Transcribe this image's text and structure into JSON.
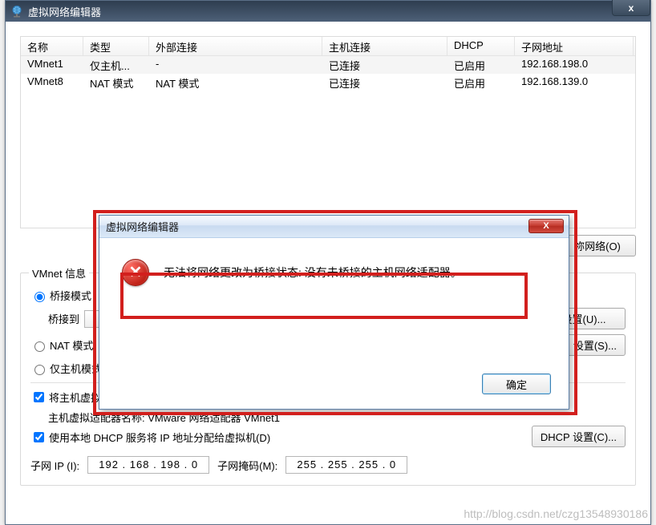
{
  "main_window": {
    "title": "虚拟网络编辑器",
    "close_glyph": "x"
  },
  "table": {
    "headers": {
      "name": "名称",
      "type": "类型",
      "external": "外部连接",
      "host_conn": "主机连接",
      "dhcp": "DHCP",
      "subnet": "子网地址"
    },
    "rows": [
      {
        "name": "VMnet1",
        "type": "仅主机...",
        "external": "-",
        "host_conn": "已连接",
        "dhcp": "已启用",
        "subnet": "192.168.198.0"
      },
      {
        "name": "VMnet8",
        "type": "NAT 模式",
        "external": "NAT 模式",
        "host_conn": "已连接",
        "dhcp": "已启用",
        "subnet": "192.168.139.0"
      }
    ]
  },
  "right_buttons": {
    "add_network_partial": "祢网络(O)"
  },
  "group": {
    "title": "VMnet 信息",
    "bridge_radio": "桥接模式",
    "bridge_to_label": "桥接到",
    "auto_settings_btn": "设置(U)...",
    "nat_radio": "NAT 模式",
    "nat_settings_btn": "设置(S)...",
    "hostonly_radio": "仅主机模式",
    "host_adapter_check": "将主机虚拟适配器连接到此网络(V)",
    "host_adapter_name_label": "主机虚拟适配器名称: VMware 网络适配器 VMnet1",
    "dhcp_check": "使用本地 DHCP 服务将 IP 地址分配给虚拟机(D)",
    "dhcp_settings_btn": "DHCP 设置(C)...",
    "subnet_ip_label": "子网 IP (I):",
    "subnet_ip_value": "192 . 168 . 198 .  0",
    "subnet_mask_label": "子网掩码(M):",
    "subnet_mask_value": "255 . 255 . 255 .  0"
  },
  "modal": {
    "title": "虚拟网络编辑器",
    "close_glyph": "X",
    "error_glyph": "✕",
    "message": "无法将网络更改为桥接状态: 没有未桥接的主机网络适配器。",
    "ok_label": "确定"
  },
  "watermark": "http://blog.csdn.net/czg13548930186"
}
